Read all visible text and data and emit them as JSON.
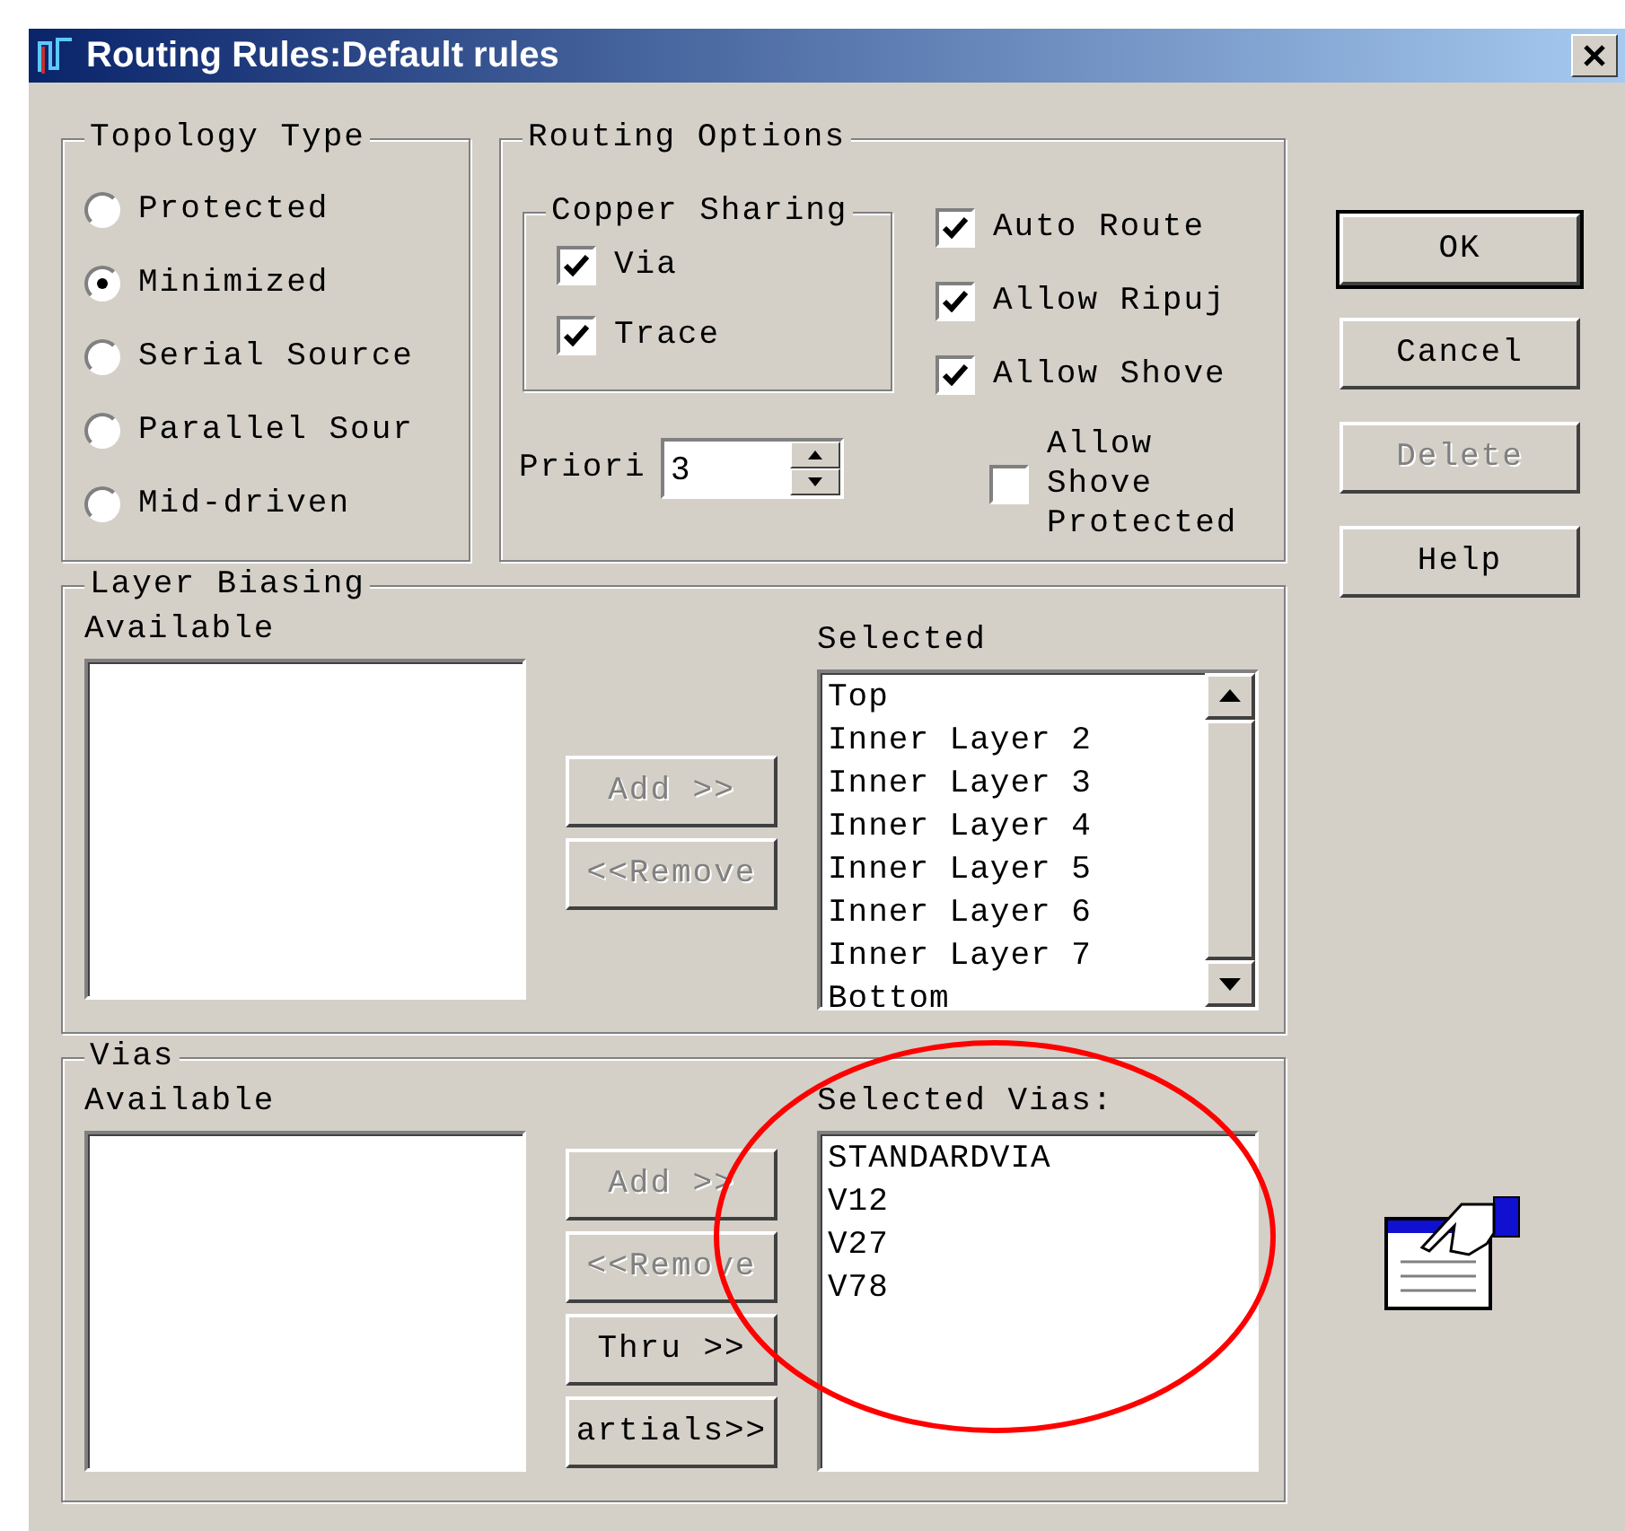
{
  "window": {
    "title": "Routing Rules:Default rules"
  },
  "topology": {
    "title": "Topology Type",
    "options": [
      {
        "label": "Protected",
        "selected": false
      },
      {
        "label": "Minimized",
        "selected": true
      },
      {
        "label": "Serial Source",
        "selected": false
      },
      {
        "label": "Parallel Sour",
        "selected": false
      },
      {
        "label": "Mid-driven",
        "selected": false
      }
    ]
  },
  "routing_options": {
    "title": "Routing Options",
    "copper_sharing": {
      "title": "Copper Sharing",
      "options": [
        {
          "label": "Via",
          "checked": true
        },
        {
          "label": "Trace",
          "checked": true
        }
      ]
    },
    "checks": [
      {
        "label": "Auto Route",
        "checked": true
      },
      {
        "label": "Allow Ripuj",
        "checked": true
      },
      {
        "label": "Allow Shove",
        "checked": true
      },
      {
        "label": "Allow Shove Protected",
        "checked": false
      }
    ],
    "priority": {
      "label": "Priori",
      "value": "3"
    }
  },
  "buttons": [
    {
      "label": "OK",
      "default": true,
      "disabled": false
    },
    {
      "label": "Cancel",
      "default": false,
      "disabled": false
    },
    {
      "label": "Delete",
      "default": false,
      "disabled": true
    },
    {
      "label": "Help",
      "default": false,
      "disabled": false
    }
  ],
  "layer_biasing": {
    "title": "Layer Biasing",
    "available_label": "Available",
    "buttons": [
      {
        "label": "Add >>",
        "disabled": true
      },
      {
        "label": "<<Remove",
        "disabled": true
      }
    ],
    "selected_label": "Selected",
    "selected_items": [
      "Top",
      "Inner Layer 2",
      "Inner Layer 3",
      "Inner Layer 4",
      "Inner Layer 5",
      "Inner Layer 6",
      "Inner Layer 7",
      "Bottom"
    ]
  },
  "vias": {
    "title": "Vias",
    "available_label": "Available",
    "buttons": [
      {
        "label": "Add >>",
        "disabled": true
      },
      {
        "label": "<<Remove",
        "disabled": true
      },
      {
        "label": "Thru >>",
        "disabled": false
      },
      {
        "label": "artials>>",
        "disabled": false
      }
    ],
    "selected_label": "Selected Vias:",
    "selected_items": [
      "STANDARDVIA",
      "V12",
      "V27",
      "V78"
    ]
  }
}
